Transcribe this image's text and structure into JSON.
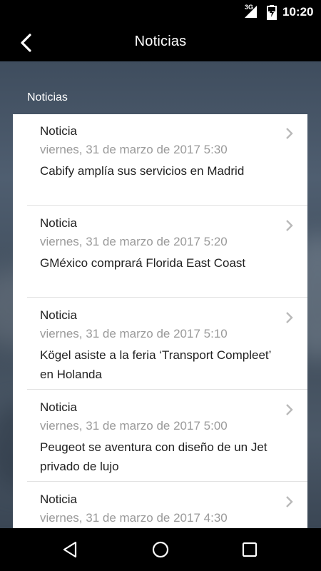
{
  "status_bar": {
    "time": "10:20",
    "network": "3G"
  },
  "app_bar": {
    "title": "Noticias"
  },
  "section": {
    "title": "Noticias"
  },
  "news": [
    {
      "category": "Noticia",
      "date": "viernes, 31 de marzo de 2017 5:30",
      "headline": "Cabify amplía sus servicios en Madrid"
    },
    {
      "category": "Noticia",
      "date": "viernes, 31 de marzo de 2017 5:20",
      "headline": "GMéxico comprará Florida East Coast"
    },
    {
      "category": "Noticia",
      "date": "viernes, 31 de marzo de 2017 5:10",
      "headline": "Kögel asiste a la feria ‘Transport Compleet’ en Holanda"
    },
    {
      "category": "Noticia",
      "date": "viernes, 31 de marzo de 2017 5:00",
      "headline": "Peugeot se aventura con diseño de un Jet privado de lujo"
    },
    {
      "category": "Noticia",
      "date": "viernes, 31 de marzo de 2017 4:30",
      "headline": ""
    }
  ]
}
